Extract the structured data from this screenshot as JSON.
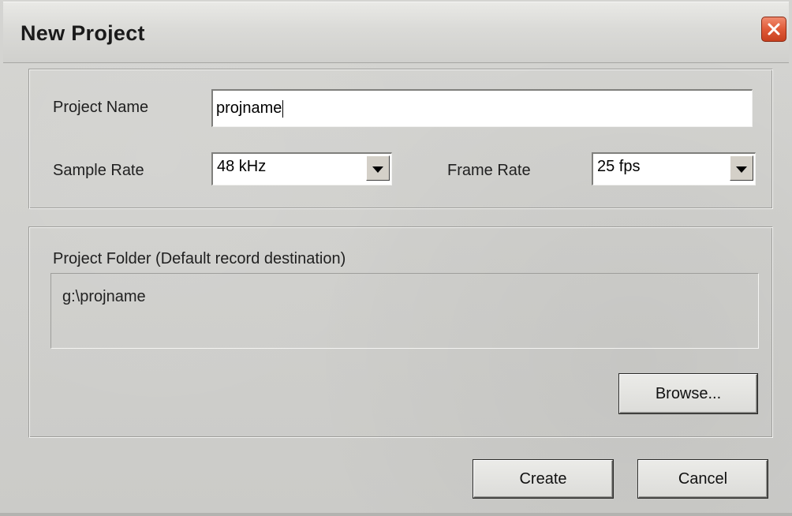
{
  "window": {
    "title": "New Project",
    "close_icon": "close-icon"
  },
  "settings": {
    "project_name_label": "Project Name",
    "project_name_value": "projname",
    "sample_rate_label": "Sample Rate",
    "sample_rate_value": "48 kHz",
    "frame_rate_label": "Frame Rate",
    "frame_rate_value": "25 fps"
  },
  "folder": {
    "label": "Project Folder  (Default record destination)",
    "path": "g:\\projname",
    "browse_label": "Browse..."
  },
  "actions": {
    "create_label": "Create",
    "cancel_label": "Cancel"
  },
  "colors": {
    "close_button": "#e05a38",
    "dialog_background": "#cfcfcc"
  }
}
